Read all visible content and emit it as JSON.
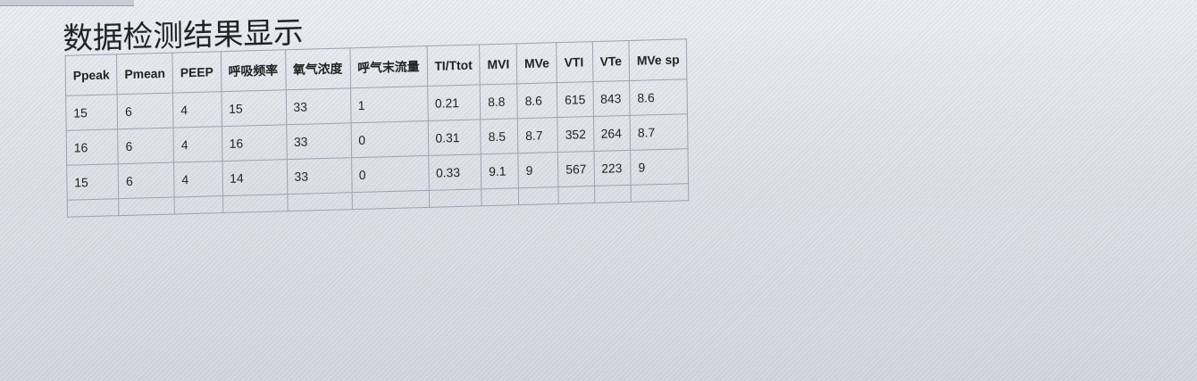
{
  "title": "数据检测结果显示",
  "table": {
    "headers": [
      "Ppeak",
      "Pmean",
      "PEEP",
      "呼吸频率",
      "氧气浓度",
      "呼气末流量",
      "TI/Ttot",
      "MVI",
      "MVe",
      "VTI",
      "VTe",
      "MVe sp"
    ],
    "rows": [
      [
        "15",
        "6",
        "4",
        "15",
        "33",
        "1",
        "0.21",
        "8.8",
        "8.6",
        "615",
        "843",
        "8.6"
      ],
      [
        "16",
        "6",
        "4",
        "16",
        "33",
        "0",
        "0.31",
        "8.5",
        "8.7",
        "352",
        "264",
        "8.7"
      ],
      [
        "15",
        "6",
        "4",
        "14",
        "33",
        "0",
        "0.33",
        "9.1",
        "9",
        "567",
        "223",
        "9"
      ],
      [
        "",
        "",
        "",
        "",
        "",
        "",
        "",
        "",
        "",
        "",
        "",
        ""
      ]
    ]
  }
}
